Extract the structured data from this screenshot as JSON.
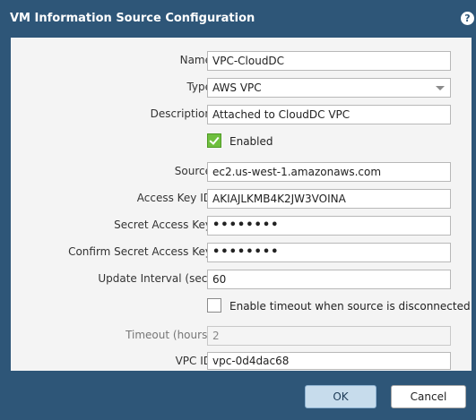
{
  "dialog": {
    "title": "VM Information Source Configuration",
    "help": "?"
  },
  "form": {
    "name": {
      "label": "Name",
      "value": "VPC-CloudDC"
    },
    "type": {
      "label": "Type",
      "value": "AWS VPC"
    },
    "description": {
      "label": "Description",
      "value": "Attached to CloudDC VPC"
    },
    "enabled": {
      "label": "Enabled",
      "checked": true
    },
    "source": {
      "label": "Source",
      "value": "ec2.us-west-1.amazonaws.com"
    },
    "access_key_id": {
      "label": "Access Key ID",
      "value": "AKIAJLKMB4K2JW3VOINA"
    },
    "secret_access_key": {
      "label": "Secret Access Key",
      "value": "••••••••"
    },
    "confirm_secret": {
      "label": "Confirm Secret Access Key",
      "value": "••••••••"
    },
    "update_interval": {
      "label": "Update Interval (sec)",
      "value": "60"
    },
    "enable_timeout": {
      "label": "Enable timeout when source is disconnected",
      "checked": false
    },
    "timeout": {
      "label": "Timeout (hours)",
      "value": "2"
    },
    "vpc_id": {
      "label": "VPC ID",
      "value": "vpc-0d4dac68"
    }
  },
  "buttons": {
    "ok": "OK",
    "cancel": "Cancel"
  },
  "colors": {
    "title_bar": "#2e5678",
    "panel": "#f4f4f4",
    "checkbox_checked": "#6fbf3e"
  }
}
